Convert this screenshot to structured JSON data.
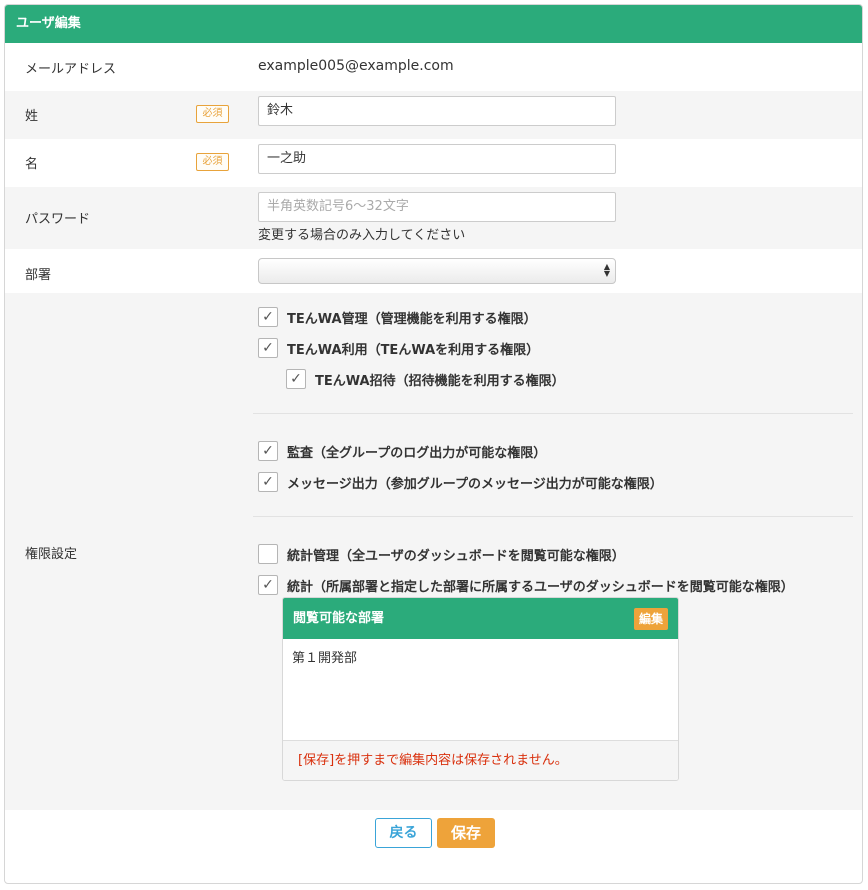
{
  "header": {
    "title": "ユーザ編集"
  },
  "required_badge": "必須",
  "fields": {
    "email": {
      "label": "メールアドレス",
      "value": "example005@example.com"
    },
    "last_name": {
      "label": "姓",
      "value": "鈴木"
    },
    "first_name": {
      "label": "名",
      "value": "一之助"
    },
    "password": {
      "label": "パスワード",
      "placeholder": "半角英数記号6〜32文字",
      "hint": "変更する場合のみ入力してください"
    },
    "department": {
      "label": "部署",
      "value": ""
    }
  },
  "permissions": {
    "label": "権限設定",
    "items": [
      {
        "label": "TEんWA管理（管理機能を利用する権限）",
        "checked": true
      },
      {
        "label": "TEんWA利用（TEんWAを利用する権限）",
        "checked": true
      },
      {
        "label": "TEんWA招待（招待機能を利用する権限）",
        "checked": true
      },
      {
        "label": "監査（全グループのログ出力が可能な権限）",
        "checked": true
      },
      {
        "label": "メッセージ出力（参加グループのメッセージ出力が可能な権限）",
        "checked": true
      },
      {
        "label": "統計管理（全ユーザのダッシュボードを閲覧可能な権限）",
        "checked": false
      },
      {
        "label": "統計（所属部署と指定した部署に所属するユーザのダッシュボードを閲覧可能な権限）",
        "checked": true
      }
    ],
    "viewable_departments": {
      "title": "閲覧可能な部署",
      "edit_label": "編集",
      "items": [
        "第１開発部"
      ],
      "notice": "[保存]を押すまで編集内容は保存されません。"
    }
  },
  "buttons": {
    "back": "戻る",
    "save": "保存"
  }
}
